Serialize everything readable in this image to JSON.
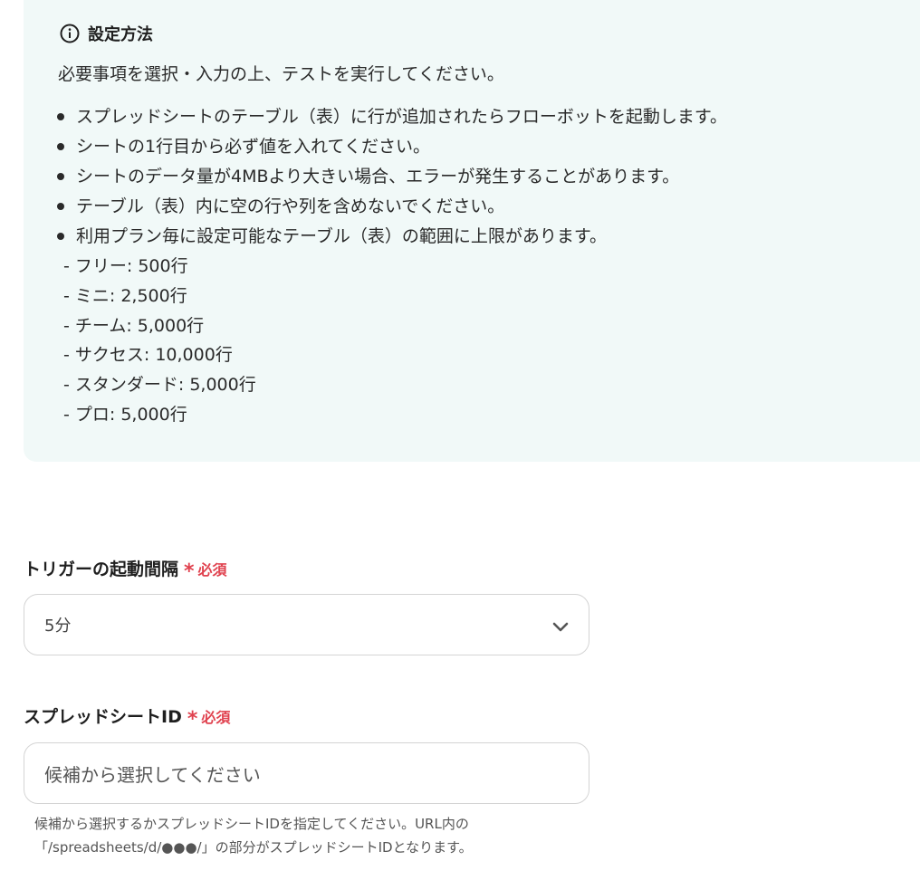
{
  "info": {
    "title": "設定方法",
    "lead": "必要事項を選択・入力の上、テストを実行してください。",
    "bullets": [
      "スプレッドシートのテーブル（表）に行が追加されたらフローボットを起動します。",
      "シートの1行目から必ず値を入れてください。",
      "シートのデータ量が4MBより大きい場合、エラーが発生することがあります。",
      "テーブル（表）内に空の行や列を含めないでください。",
      "利用プラン毎に設定可能なテーブル（表）の範囲に上限があります。"
    ],
    "plans": [
      "- フリー: 500行",
      "- ミニ: 2,500行",
      "- チーム: 5,000行",
      "- サクセス: 10,000行",
      "- スタンダード: 5,000行",
      "- プロ: 5,000行"
    ]
  },
  "trigger_interval": {
    "label": "トリガーの起動間隔",
    "required_star": "*",
    "required_text": "必須",
    "selected_value": "5分"
  },
  "spreadsheet_id": {
    "label": "スプレッドシートID",
    "required_star": "*",
    "required_text": "必須",
    "placeholder": "候補から選択してください",
    "help_line1": "候補から選択するかスプレッドシートIDを指定してください。URL内の",
    "help_line2": "「/spreadsheets/d/●●●/」の部分がスプレッドシートIDとなります。"
  },
  "colors": {
    "panel_bg": "#f1f9f8",
    "required": "#e0424f",
    "border": "#d4d4d4"
  },
  "icons": {
    "info": "info-circle-icon",
    "dropdown": "chevron-down-icon"
  }
}
